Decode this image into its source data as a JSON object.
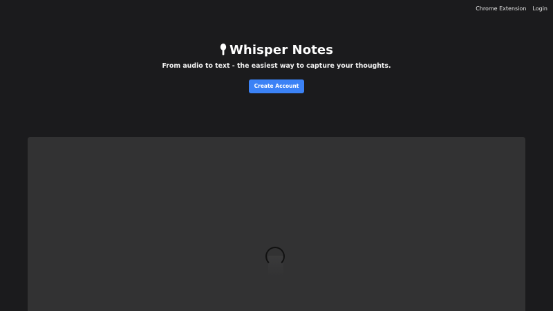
{
  "nav": {
    "items": [
      {
        "label": "Chrome Extension"
      },
      {
        "label": "Login"
      }
    ]
  },
  "hero": {
    "icon": "microphone-icon",
    "title": "Whisper Notes",
    "subtitle": "From audio to text - the easiest way to capture your thoughts.",
    "cta_label": "Create Account"
  },
  "colors": {
    "background": "#1b1b1d",
    "accent": "#3b82f6",
    "panel": "#323233"
  }
}
